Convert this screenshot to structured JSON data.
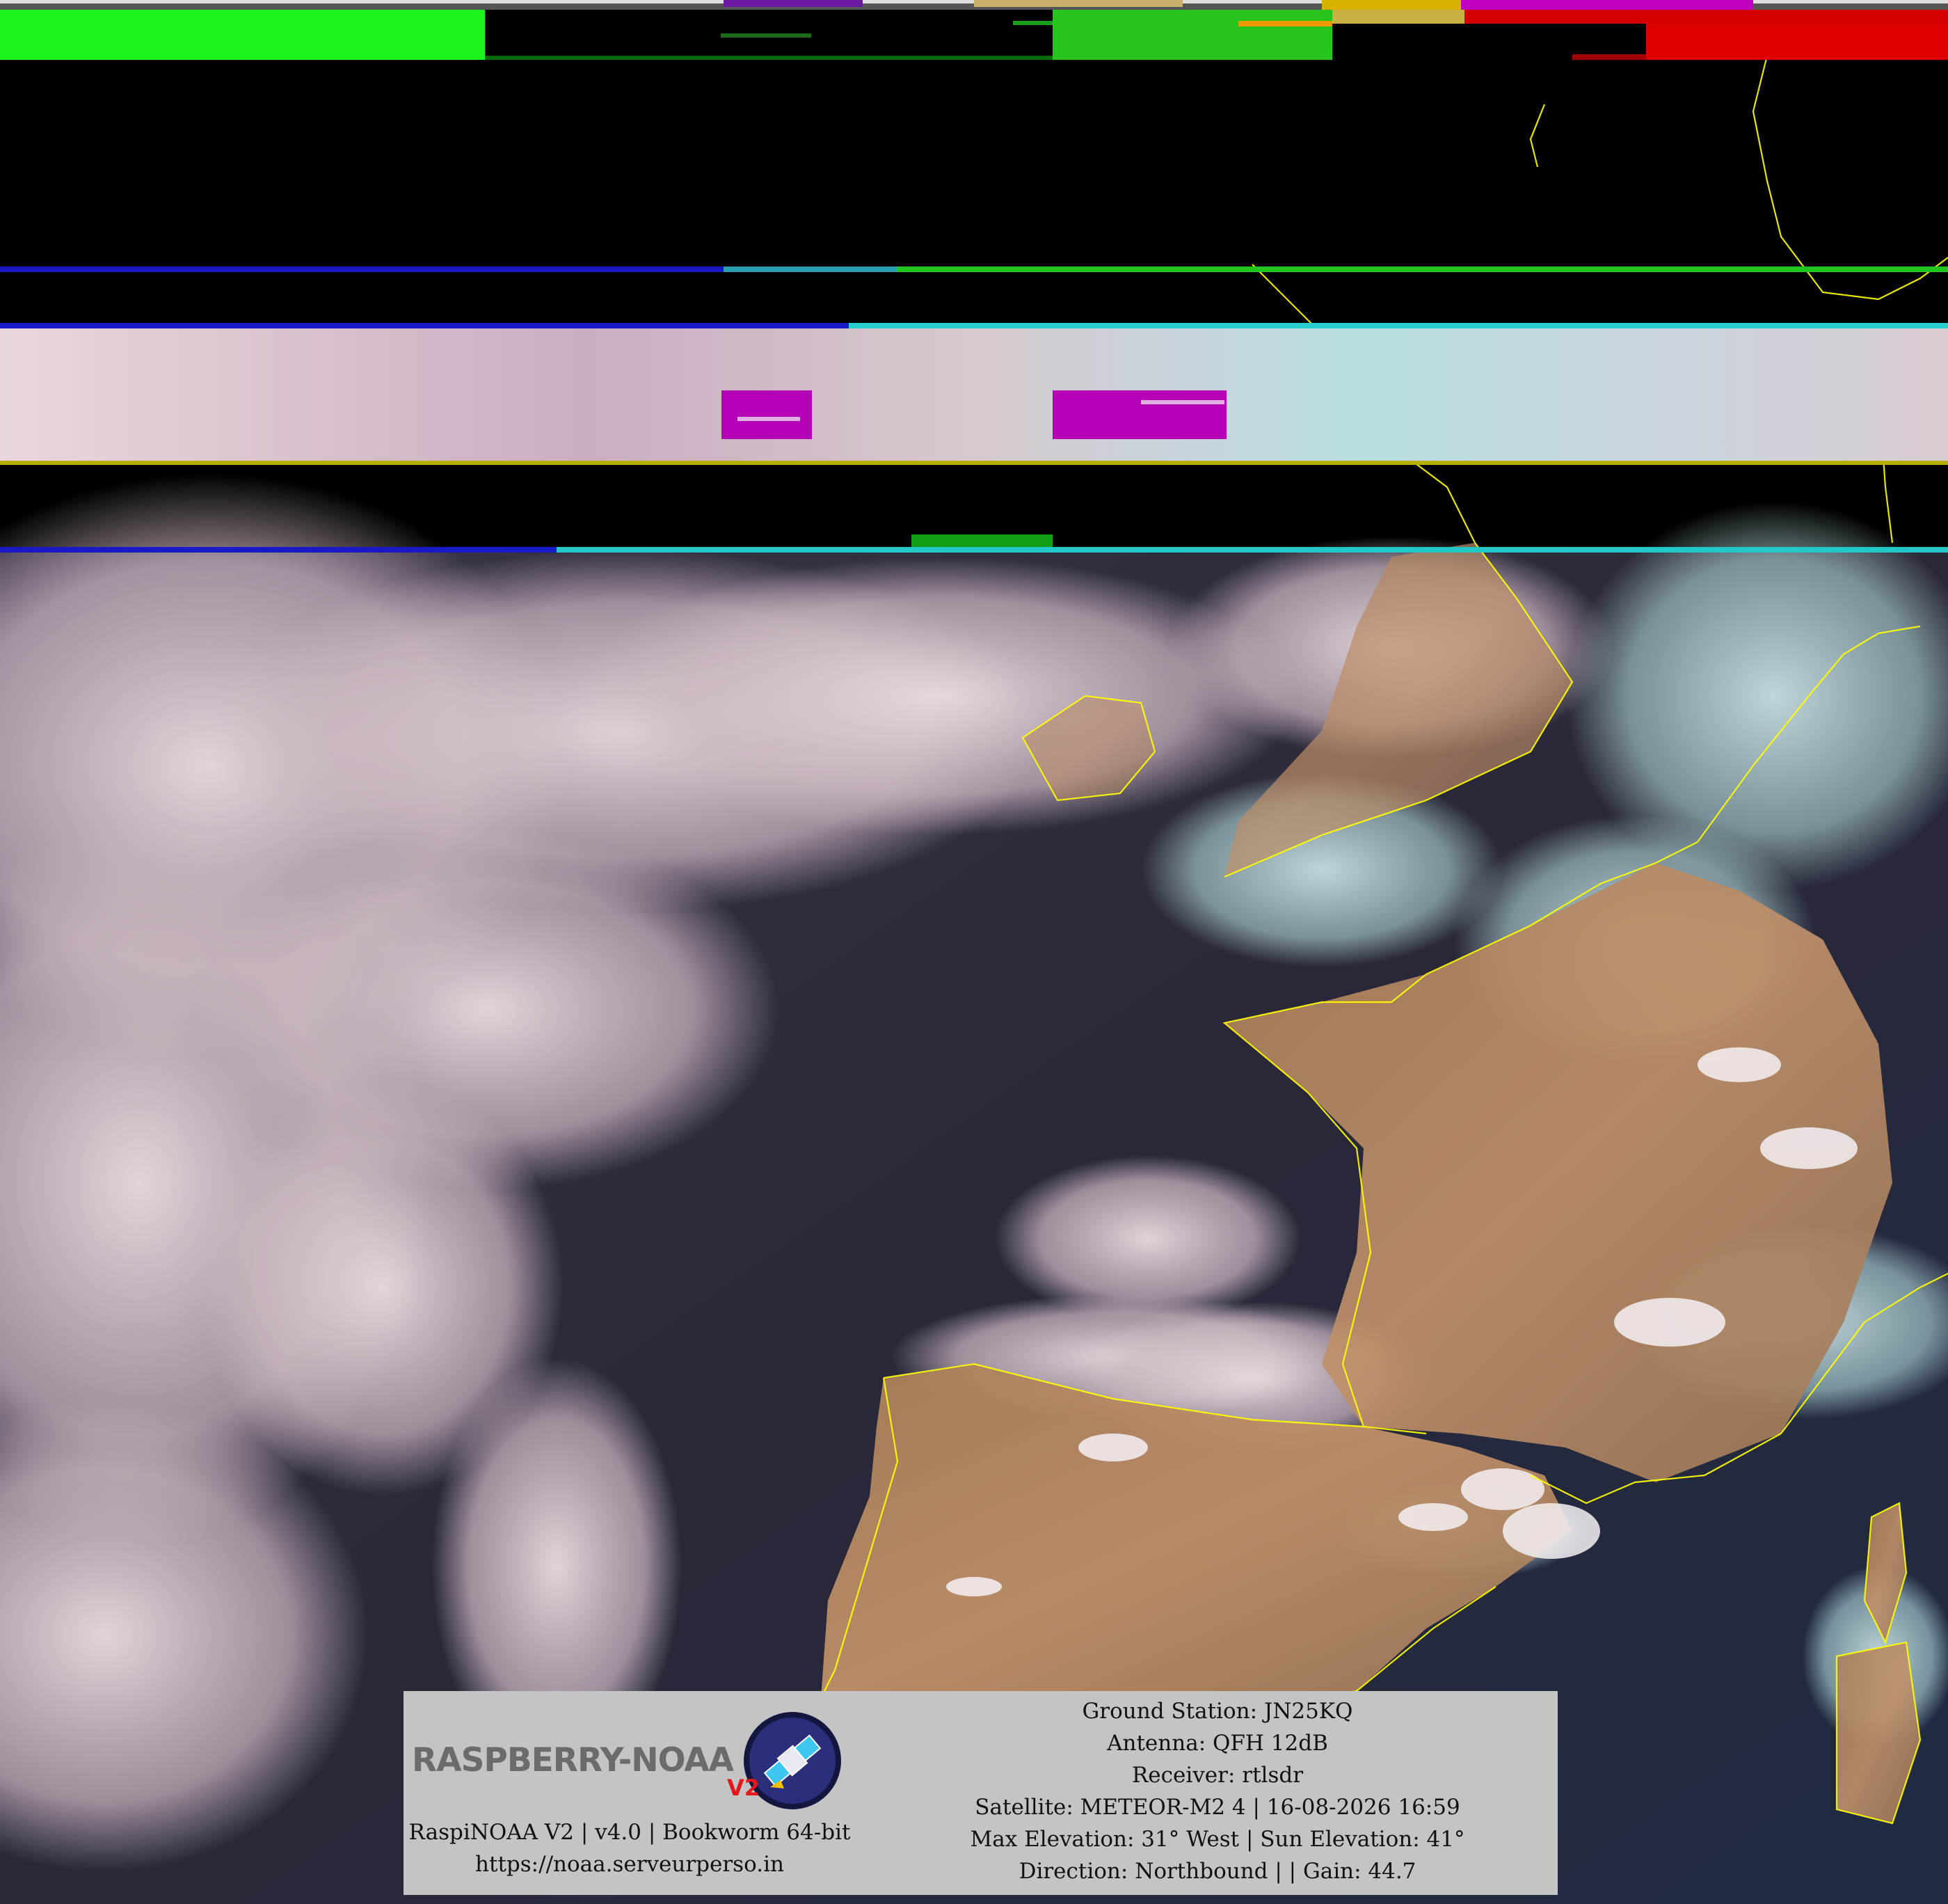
{
  "overlay": {
    "logo_text": "RASPBERRY-NOAA",
    "logo_badge": "V2",
    "software_line": "RaspiNOAA V2 | v4.0 | Bookworm 64-bit",
    "url": "https://noaa.serveurperso.in",
    "ground_station": "Ground Station: JN25KQ",
    "antenna": "Antenna: QFH 12dB",
    "receiver": "Receiver: rtlsdr",
    "satellite": "Satellite: METEOR-M2 4 | 16-08-2026 16:59",
    "elevation": "Max Elevation: 31° West | Sun Elevation: 41°",
    "direction": "Direction: Northbound |  | Gain: 44.7"
  },
  "colors": {
    "ocean": "#2a2838",
    "cloud": "#e8d4dc",
    "land": "#b58a62",
    "coastline": "#ffff00",
    "overlay_bg": "#c4c4c4",
    "glitch_green": "#00ff00",
    "glitch_red": "#e00000",
    "glitch_magenta": "#b000b0"
  },
  "icons": [
    "satellite-logo-icon"
  ]
}
